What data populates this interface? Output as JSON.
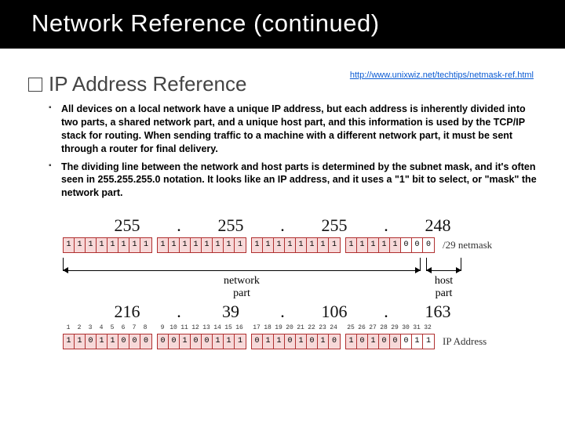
{
  "title": "Network Reference (continued)",
  "url": "http://www.unixwiz.net/techtips/netmask-ref.html",
  "subhead": "IP Address Reference",
  "bullets": [
    "All devices on a local network have a unique IP address, but each address is inherently divided into two parts, a shared network part, and a unique host part, and this information is used by the TCP/IP stack for routing. When sending traffic to a machine with a different network part, it must be sent through a router for final delivery.",
    "The dividing line between the network and host parts is determined by the subnet mask, and it's often seen in 255.255.255.0 notation. It looks like an IP address, and it uses a \"1\" bit to select, or \"mask\" the network part."
  ],
  "netmask": {
    "octets": [
      "255",
      "255",
      "255",
      "248"
    ],
    "bits": [
      "1",
      "1",
      "1",
      "1",
      "1",
      "1",
      "1",
      "1",
      "1",
      "1",
      "1",
      "1",
      "1",
      "1",
      "1",
      "1",
      "1",
      "1",
      "1",
      "1",
      "1",
      "1",
      "1",
      "1",
      "1",
      "1",
      "1",
      "1",
      "1",
      "0",
      "0",
      "0"
    ],
    "label": "/29 netmask"
  },
  "bracket": {
    "network": "network\npart",
    "host": "host\npart"
  },
  "ip": {
    "octets": [
      "216",
      "39",
      "106",
      "163"
    ],
    "positions": [
      "1",
      "2",
      "3",
      "4",
      "5",
      "6",
      "7",
      "8",
      "9",
      "10",
      "11",
      "12",
      "13",
      "14",
      "15",
      "16",
      "17",
      "18",
      "19",
      "20",
      "21",
      "22",
      "23",
      "24",
      "25",
      "26",
      "27",
      "28",
      "29",
      "30",
      "31",
      "32"
    ],
    "bits": [
      "1",
      "1",
      "0",
      "1",
      "1",
      "0",
      "0",
      "0",
      "0",
      "0",
      "1",
      "0",
      "0",
      "1",
      "1",
      "1",
      "0",
      "1",
      "1",
      "0",
      "1",
      "0",
      "1",
      "0",
      "1",
      "0",
      "1",
      "0",
      "0",
      "0",
      "1",
      "1"
    ],
    "label": "IP Address"
  }
}
